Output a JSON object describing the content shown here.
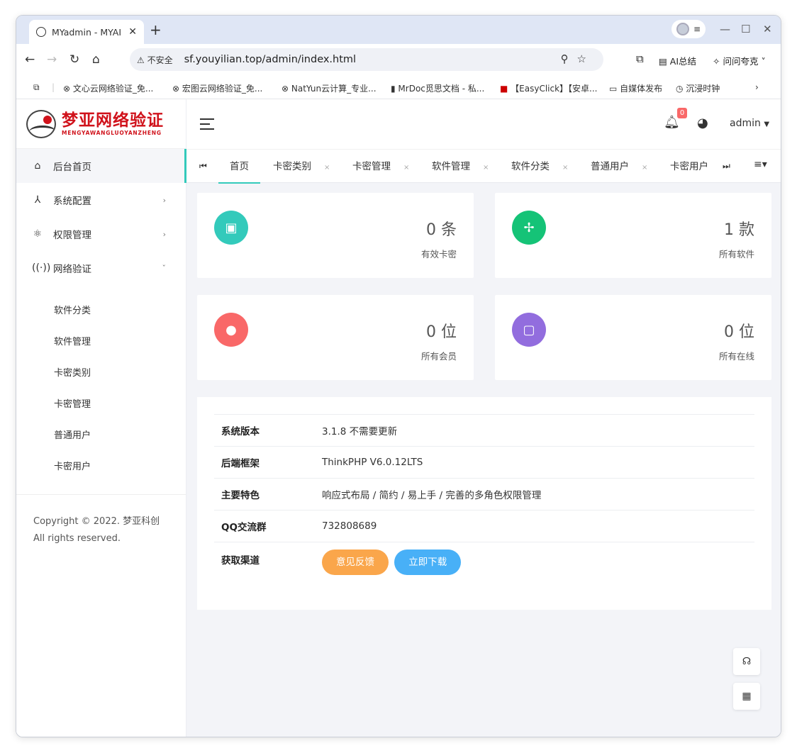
{
  "browser": {
    "tab_title": "MYadmin - MYAI",
    "tab_close": "✕",
    "new_tab": "+",
    "address": "sf.youyilian.top/admin/index.html",
    "insecure_label": "不安全",
    "ai_summary": "AI总结",
    "ask_label": "问问夸克",
    "bookmarks": [
      "文心云网络验证_免...",
      "宏图云网络验证_免...",
      "NatYun云计算_专业...",
      "MrDoc觅思文档 - 私...",
      "【EasyClick】【安卓...",
      "自媒体发布",
      "沉浸时钟"
    ]
  },
  "sidebar": {
    "logo_cn": "梦亚网络验证",
    "logo_en": "MENGYAWANGLUOYANZHENG",
    "menu": [
      {
        "label": "后台首页",
        "icon": "home-icon"
      },
      {
        "label": "系统配置",
        "icon": "tools-icon"
      },
      {
        "label": "权限管理",
        "icon": "permission-icon"
      },
      {
        "label": "网络验证",
        "icon": "signal-icon"
      }
    ],
    "submenu": [
      "软件分类",
      "软件管理",
      "卡密类别",
      "卡密管理",
      "普通用户",
      "卡密用户"
    ],
    "copyright": "Copyright © 2022. 梦亚科创 All rights reserved."
  },
  "topbar": {
    "notification_count": "0",
    "username": "admin"
  },
  "tabs": [
    "首页",
    "卡密类别",
    "卡密管理",
    "软件管理",
    "软件分类",
    "普通用户",
    "卡密用户"
  ],
  "cards": [
    {
      "value": "0 条",
      "label": "有效卡密",
      "color": "#33cabb",
      "icon": "card-icon"
    },
    {
      "value": "1 款",
      "label": "所有软件",
      "color": "#15c377",
      "icon": "pinwheel-icon"
    },
    {
      "value": "0 位",
      "label": "所有会员",
      "color": "#f96868",
      "icon": "user-icon"
    },
    {
      "value": "0 位",
      "label": "所有在线",
      "color": "#926dde",
      "icon": "chat-icon"
    }
  ],
  "info": [
    {
      "key": "系统版本",
      "value": "3.1.8 不需要更新"
    },
    {
      "key": "后端框架",
      "value": "ThinkPHP V6.0.12LTS"
    },
    {
      "key": "主要特色",
      "value": "响应式布局 / 简约 / 易上手 / 完善的多角色权限管理"
    },
    {
      "key": "QQ交流群",
      "value": "732808689"
    },
    {
      "key": "获取渠道",
      "value": ""
    }
  ],
  "buttons": {
    "feedback": "意见反馈",
    "download": "立即下载",
    "feedback_color": "#faa64b",
    "download_color": "#48b0f7"
  }
}
